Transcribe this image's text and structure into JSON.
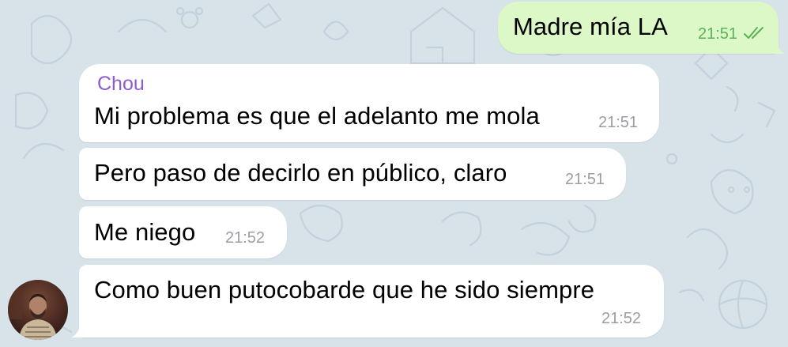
{
  "conversation": {
    "outgoing": [
      {
        "text": "Madre mía LA",
        "time": "21:51",
        "status": "read"
      }
    ],
    "incoming": {
      "sender": "Chou",
      "messages": [
        {
          "text": "Mi problema es que el adelanto me mola",
          "time": "21:51"
        },
        {
          "text": "Pero paso de decirlo en público, claro",
          "time": "21:51"
        },
        {
          "text": "Me niego",
          "time": "21:52"
        },
        {
          "text": "Como buen putocobarde que he sido siempre",
          "time": "21:52"
        }
      ]
    }
  },
  "colors": {
    "background": "#d7e2e9",
    "incoming_bubble": "#ffffff",
    "outgoing_bubble": "#dcf8c6",
    "sender_name": "#8e5bd3",
    "outgoing_time": "#5bb25a",
    "incoming_time": "#9a9ea3"
  }
}
